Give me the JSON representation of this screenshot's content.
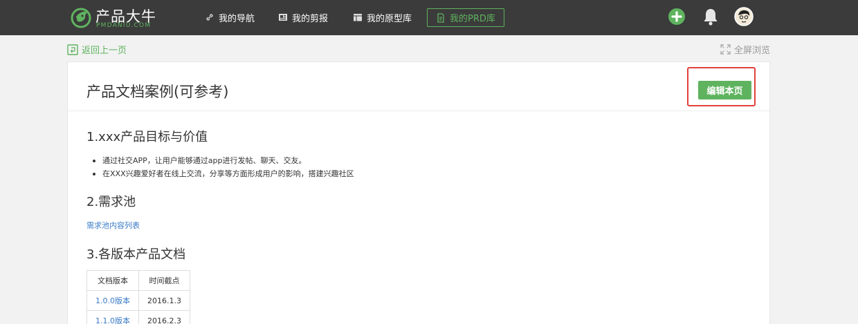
{
  "brand": {
    "name": "产品大牛",
    "domain": "PMDANIU.COM",
    "accent": "#5fb35f"
  },
  "nav": {
    "items": [
      {
        "label": "我的导航",
        "icon": "link-icon"
      },
      {
        "label": "我的剪报",
        "icon": "clipping-icon"
      },
      {
        "label": "我的原型库",
        "icon": "layout-icon"
      },
      {
        "label": "我的PRD库",
        "icon": "document-icon",
        "active": true
      }
    ],
    "icons": [
      "add-icon",
      "bell-icon",
      "avatar"
    ]
  },
  "subbar": {
    "back_label": "返回上一页",
    "fullscreen_label": "全屏浏览"
  },
  "page": {
    "title": "产品文档案例(可参考)",
    "edit_label": "编辑本页",
    "highlight_color": "#e0403b"
  },
  "content": {
    "section1": {
      "heading": "1.xxx产品目标与价值",
      "bullets": [
        "通过社交APP，让用户能够通过app进行发帖、聊天、交友。",
        "在XXX兴趣爱好者在线上交流，分享等方面形成用户的影响，搭建兴趣社区"
      ]
    },
    "section2": {
      "heading": "2.需求池",
      "link": "需求池内容列表"
    },
    "section3": {
      "heading": "3.各版本产品文档",
      "table": {
        "headers": [
          "文档版本",
          "时间截点"
        ],
        "rows": [
          [
            "1.0.0版本",
            "2016.1.3"
          ],
          [
            "1.1.0版本",
            "2016.2.3"
          ]
        ]
      }
    }
  }
}
